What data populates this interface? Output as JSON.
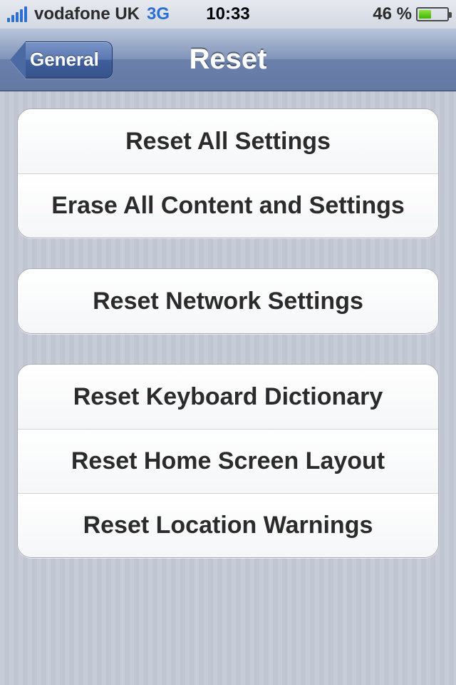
{
  "status": {
    "carrier": "vodafone UK",
    "connection": "3G",
    "time": "10:33",
    "battery_pct": "46 %"
  },
  "nav": {
    "back_label": "General",
    "title": "Reset"
  },
  "groups": [
    {
      "items": [
        {
          "label": "Reset All Settings"
        },
        {
          "label": "Erase All Content and Settings"
        }
      ]
    },
    {
      "items": [
        {
          "label": "Reset Network Settings"
        }
      ]
    },
    {
      "items": [
        {
          "label": "Reset Keyboard Dictionary"
        },
        {
          "label": "Reset Home Screen Layout"
        },
        {
          "label": "Reset Location Warnings"
        }
      ]
    }
  ]
}
